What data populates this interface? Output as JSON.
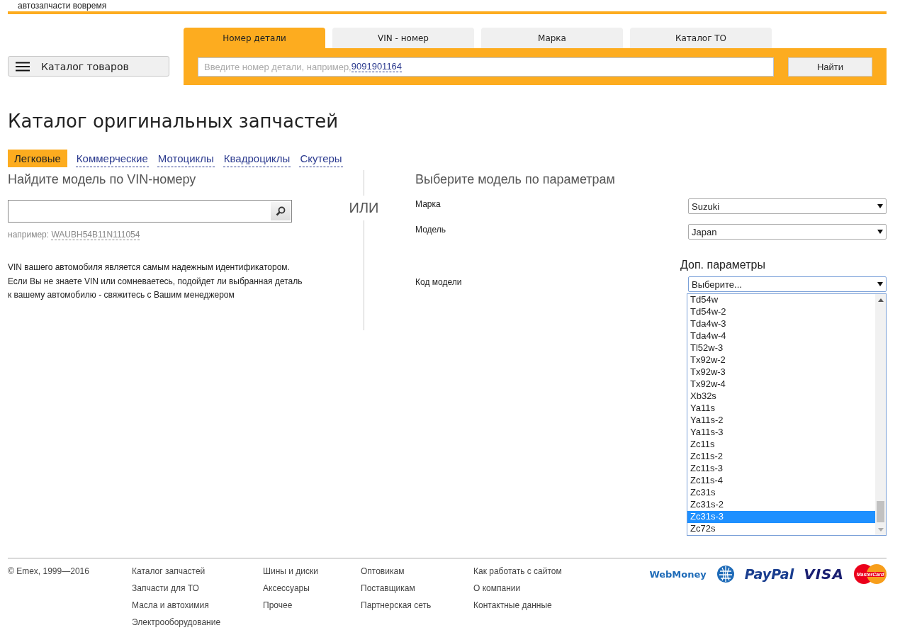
{
  "header": {
    "tagline": "автозапчасти вовремя",
    "catalog_button": "Каталог товаров"
  },
  "search_tabs": [
    {
      "label": "Номер детали",
      "selected": true
    },
    {
      "label": "VIN - номер",
      "selected": false
    },
    {
      "label": "Марка",
      "selected": false
    },
    {
      "label": "Каталог ТО",
      "selected": false
    }
  ],
  "search": {
    "placeholder": "Введите номер детали, например, ",
    "example": "9091901164",
    "button": "Найти"
  },
  "title": "Каталог оригинальных запчастей",
  "categories": [
    {
      "label": "Легковые",
      "selected": true
    },
    {
      "label": "Коммерческие",
      "selected": false
    },
    {
      "label": "Мотоциклы",
      "selected": false
    },
    {
      "label": "Квадроциклы",
      "selected": false
    },
    {
      "label": "Скутеры",
      "selected": false
    }
  ],
  "vin_panel": {
    "heading": "Найдите модель по VIN-номеру",
    "example_label": "например:",
    "example": "WAUBH54B11N111054",
    "description": [
      "VIN вашего автомобиля является самым надежным идентификатором.",
      "Если Вы не знаете VIN или сомневаетесь, подойдет ли выбранная деталь",
      "к вашему автомобилю - свяжитесь с Вашим менеджером"
    ]
  },
  "divider_label": "ИЛИ",
  "params_panel": {
    "heading": "Выберите модель по параметрам",
    "fields": [
      {
        "label": "Марка",
        "value": "Suzuki"
      },
      {
        "label": "Модель",
        "value": "Japan"
      }
    ],
    "extra_heading": "Доп. параметры",
    "code_field": {
      "label": "Код модели",
      "value": "Выберите..."
    },
    "options": [
      {
        "label": "Td54w",
        "selected": false
      },
      {
        "label": "Td54w-2",
        "selected": false
      },
      {
        "label": "Tda4w-3",
        "selected": false
      },
      {
        "label": "Tda4w-4",
        "selected": false
      },
      {
        "label": "Tl52w-3",
        "selected": false
      },
      {
        "label": "Tx92w-2",
        "selected": false
      },
      {
        "label": "Tx92w-3",
        "selected": false
      },
      {
        "label": "Tx92w-4",
        "selected": false
      },
      {
        "label": "Xb32s",
        "selected": false
      },
      {
        "label": "Ya11s",
        "selected": false
      },
      {
        "label": "Ya11s-2",
        "selected": false
      },
      {
        "label": "Ya11s-3",
        "selected": false
      },
      {
        "label": "Zc11s",
        "selected": false
      },
      {
        "label": "Zc11s-2",
        "selected": false
      },
      {
        "label": "Zc11s-3",
        "selected": false
      },
      {
        "label": "Zc11s-4",
        "selected": false
      },
      {
        "label": "Zc31s",
        "selected": false
      },
      {
        "label": "Zc31s-2",
        "selected": false
      },
      {
        "label": "Zc31s-3",
        "selected": true
      },
      {
        "label": "Zc72s",
        "selected": false
      }
    ]
  },
  "footer": {
    "copyright": "© Emex, 1999—2016",
    "columns": [
      [
        "Каталог запчастей",
        "Запчасти для ТО",
        "Масла и автохимия",
        "Электрооборудование"
      ],
      [
        "Шины и диски",
        "Аксессуары",
        "Прочее"
      ],
      [
        "Оптовикам",
        "Поставщикам",
        "Партнерская сеть"
      ],
      [
        "Как работать с сайтом",
        "О компании",
        "Контактные данные"
      ]
    ],
    "payments": [
      "WebMoney",
      "PayPal",
      "VISA",
      "MasterCard"
    ]
  }
}
